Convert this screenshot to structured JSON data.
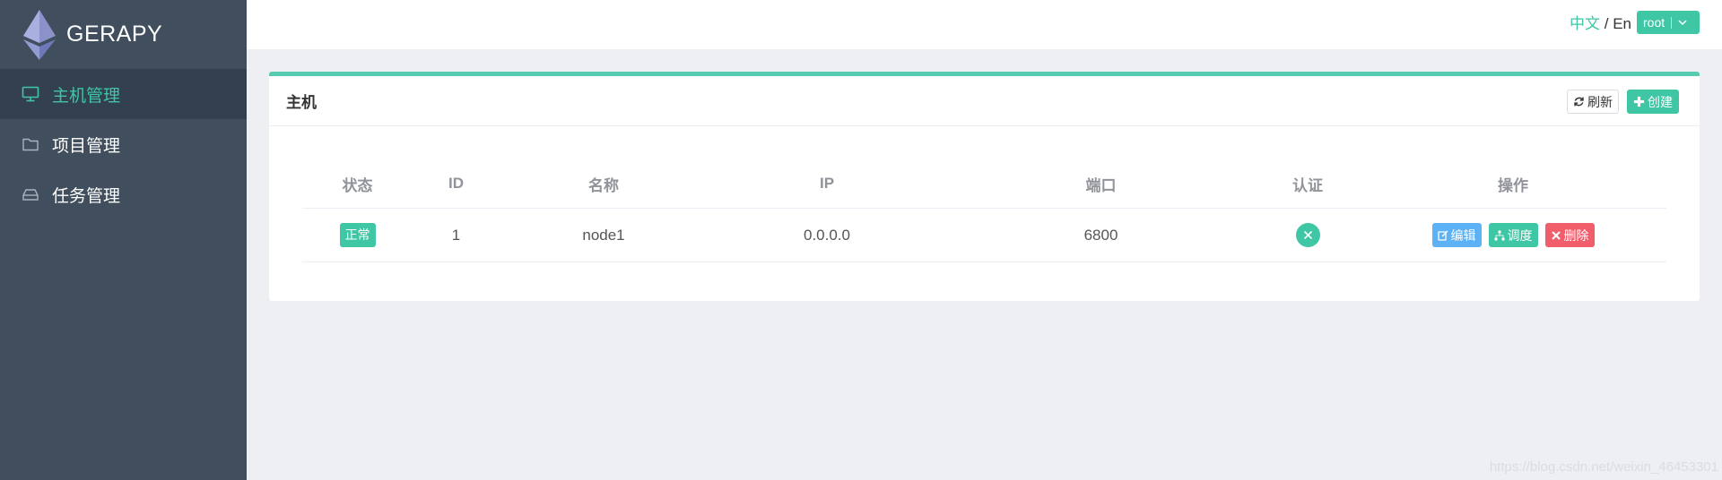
{
  "app": {
    "name": "GERAPY"
  },
  "sidebar": {
    "items": [
      {
        "label": "主机管理",
        "icon": "monitor-icon",
        "active": true
      },
      {
        "label": "项目管理",
        "icon": "folder-icon",
        "active": false
      },
      {
        "label": "任务管理",
        "icon": "inbox-icon",
        "active": false
      }
    ]
  },
  "header": {
    "lang_zh": "中文",
    "lang_sep": " / ",
    "lang_en": "En",
    "user": "root"
  },
  "card": {
    "title": "主机",
    "refresh_label": "刷新",
    "create_label": "创建"
  },
  "table": {
    "columns": [
      "状态",
      "ID",
      "名称",
      "IP",
      "端口",
      "认证",
      "操作"
    ],
    "rows": [
      {
        "status": "正常",
        "id": "1",
        "name": "node1",
        "ip": "0.0.0.0",
        "port": "6800",
        "auth_icon": "x-icon",
        "actions": [
          "编辑",
          "调度",
          "删除"
        ]
      }
    ]
  },
  "colors": {
    "accent": "#3fc6a4",
    "sidebar_bg": "#404e5e",
    "edit": "#5cb2f5",
    "delete": "#f25d6b"
  },
  "watermark": "https://blog.csdn.net/weixin_46453301"
}
